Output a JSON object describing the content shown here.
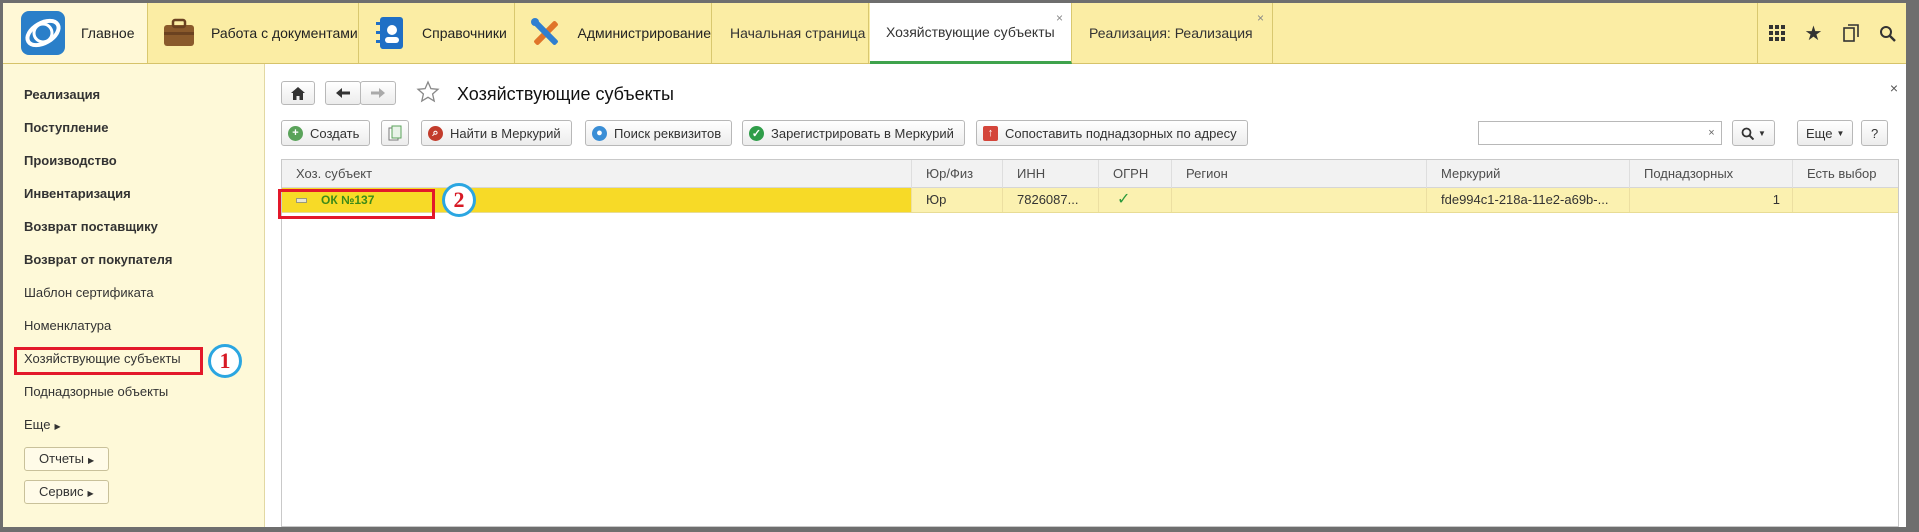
{
  "topbar": {
    "sections": {
      "home": "Главное",
      "docs": "Работа с документами",
      "ref": "Справочники",
      "admin": "Администрирование"
    },
    "tabs": {
      "start": "Начальная страница",
      "subjects": "Хозяйствующие субъекты",
      "realization": "Реализация: Реализация"
    },
    "close_glyph": "×"
  },
  "sidebar": {
    "items": [
      "Реализация",
      "Поступление",
      "Производство",
      "Инвентаризация",
      "Возврат поставщику",
      "Возврат от покупателя",
      "Шаблон сертификата",
      "Номенклатура",
      "Хозяйствующие субъекты",
      "Поднадзорные объекты",
      "Еще"
    ],
    "reports": "Отчеты",
    "service": "Сервис"
  },
  "main": {
    "title": "Хозяйствующие субъекты",
    "close_glyph": "×",
    "commands": {
      "create": "Создать",
      "find_mercury": "Найти в Меркурий",
      "find_requisites": "Поиск реквизитов",
      "register_mercury": "Зарегистрировать в Меркурий",
      "match_by_address": "Сопоставить поднадзорных по адресу",
      "more": "Еще",
      "help": "?"
    },
    "search": {
      "value": "",
      "clear": "×"
    }
  },
  "table": {
    "columns": [
      "Хоз. субъект",
      "Юр/Физ",
      "ИНН",
      "ОГРН",
      "Регион",
      "Меркурий",
      "Поднадзорных",
      "Есть выбор"
    ],
    "rows": [
      {
        "name": "ОК №137",
        "type": "Юр",
        "inn": "7826087...",
        "ogrn": "✓",
        "region": "",
        "mercury": "fde994c1-218a-11e2-a69b-...",
        "supervised": "1",
        "has_choice": ""
      }
    ]
  },
  "annotations": {
    "marker1": "1",
    "marker2": "2"
  },
  "colors": {
    "accent_yellow": "#fbeda4",
    "row_highlight": "#f7da27",
    "active_tab_underline": "#3fa34d",
    "annotation_red": "#e3182a",
    "annotation_blue": "#2ba6e1"
  }
}
